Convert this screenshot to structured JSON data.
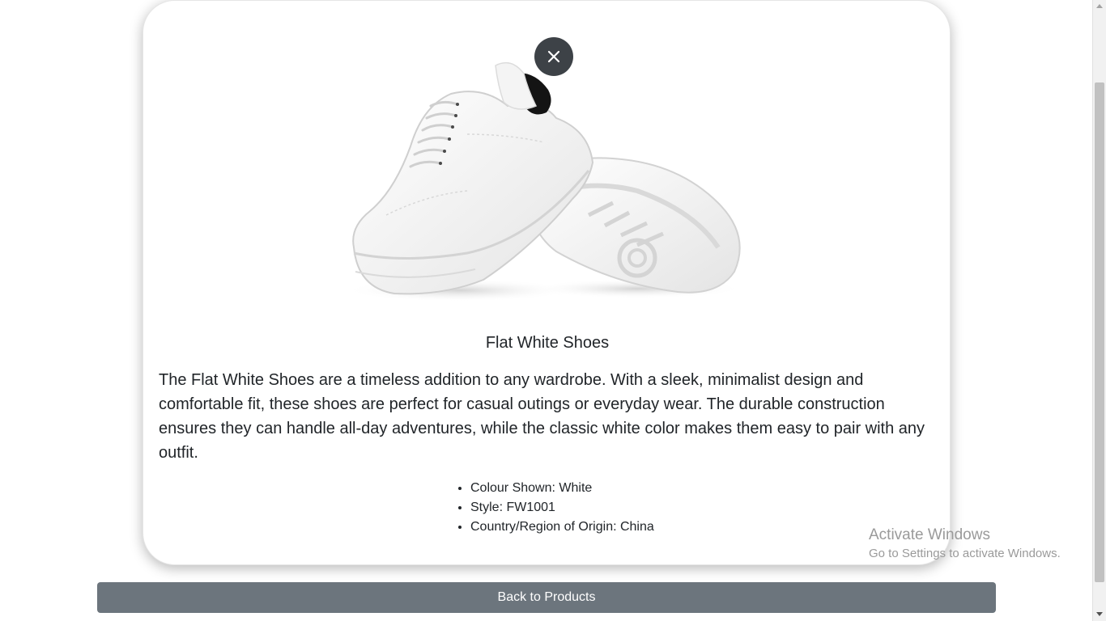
{
  "product": {
    "title": "Flat White Shoes",
    "image_alt": "Pair of flat white platform sneakers",
    "description": "The Flat White Shoes are a timeless addition to any wardrobe. With a sleek, minimalist design and comfortable fit, these shoes are perfect for casual outings or everyday wear. The durable construction ensures they can handle all-day adventures, while the classic white color makes them easy to pair with any outfit.",
    "specs": [
      "Colour Shown: White",
      "Style: FW1001",
      "Country/Region of Origin: China"
    ]
  },
  "close_button": {
    "icon": "close-icon",
    "color": "#3d4247"
  },
  "back_button": {
    "label": "Back to Products",
    "color": "#6c757d"
  },
  "watermark": {
    "title": "Activate Windows",
    "subtitle": "Go to Settings to activate Windows."
  }
}
